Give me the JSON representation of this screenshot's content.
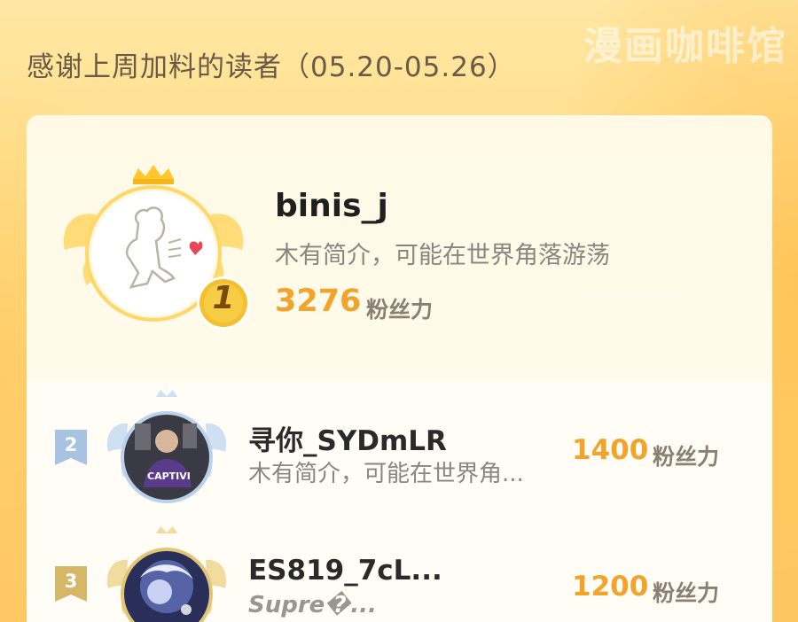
{
  "watermark": "漫画咖啡馆",
  "header": {
    "title": "感谢上周加料的读者（05.20-05.26）"
  },
  "first": {
    "rank": "1",
    "name": "binis_j",
    "bio": "木有简介，可能在世界角落游荡",
    "score": "3276",
    "score_unit": "粉丝力"
  },
  "list": [
    {
      "rank": "2",
      "name": "寻你_SYDmLR",
      "bio": "木有简介，可能在世界角...",
      "score": "1400",
      "score_unit": "粉丝力",
      "avatar_text": "CAPTIVI"
    },
    {
      "rank": "3",
      "name": "ES819_7cL...",
      "bio": "Supre�...",
      "score": "1200",
      "score_unit": "粉丝力"
    }
  ],
  "colors": {
    "accent": "#f2a32a",
    "gold": "#f4c02f",
    "silver": "#9fb8d8",
    "bronze": "#d4b15a"
  }
}
